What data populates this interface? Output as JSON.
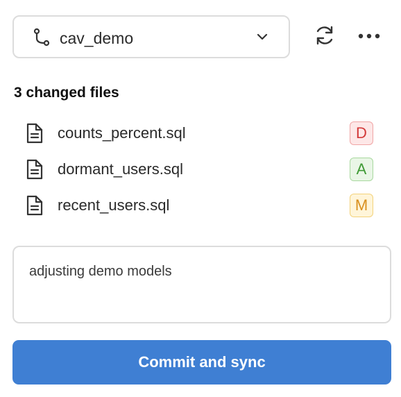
{
  "branch": {
    "name": "cav_demo",
    "icon": "git-branch-icon"
  },
  "toolbar": {
    "sync_icon": "refresh-icon",
    "more_icon": "more-horizontal-icon"
  },
  "changes": {
    "title": "3 changed files",
    "files": [
      {
        "name": "counts_percent.sql",
        "status": "D",
        "status_color": "#d33a3a"
      },
      {
        "name": "dormant_users.sql",
        "status": "A",
        "status_color": "#3f9a35"
      },
      {
        "name": "recent_users.sql",
        "status": "M",
        "status_color": "#d9901e"
      }
    ]
  },
  "commit": {
    "message": "adjusting demo models",
    "button_label": "Commit and sync",
    "button_color": "#3f7fd3"
  }
}
